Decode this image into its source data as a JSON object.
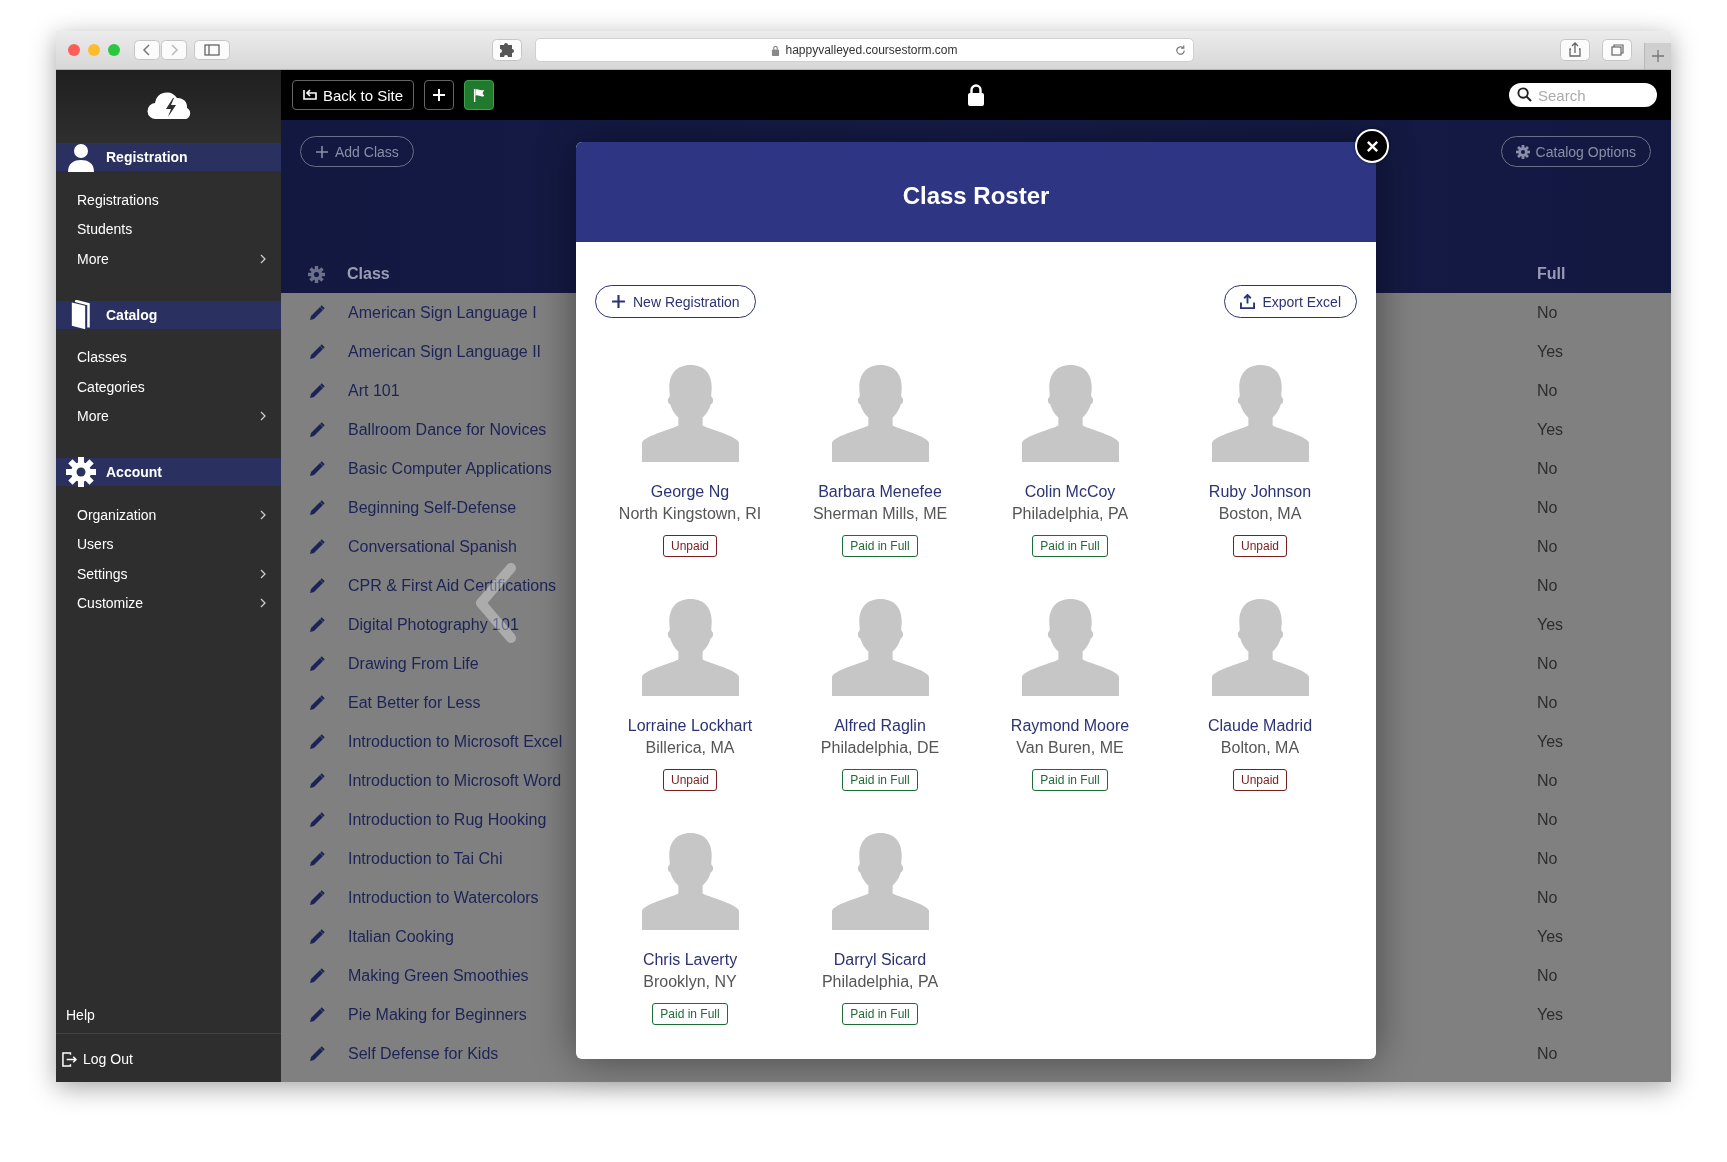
{
  "browser": {
    "url": "happyvalleyed.coursestorm.com"
  },
  "sidebar": {
    "sections": [
      {
        "title": "Registration",
        "kind": "person",
        "items": [
          {
            "label": "Registrations",
            "has_submenu": false
          },
          {
            "label": "Students",
            "has_submenu": false
          },
          {
            "label": "More",
            "has_submenu": true
          }
        ]
      },
      {
        "title": "Catalog",
        "kind": "book",
        "items": [
          {
            "label": "Classes",
            "has_submenu": false
          },
          {
            "label": "Categories",
            "has_submenu": false
          },
          {
            "label": "More",
            "has_submenu": true
          }
        ]
      },
      {
        "title": "Account",
        "kind": "gear",
        "items": [
          {
            "label": "Organization",
            "has_submenu": true
          },
          {
            "label": "Users",
            "has_submenu": false
          },
          {
            "label": "Settings",
            "has_submenu": true
          },
          {
            "label": "Customize",
            "has_submenu": true
          }
        ]
      }
    ],
    "help": "Help",
    "logout": "Log Out"
  },
  "topbar": {
    "back_button": "Back to Site",
    "search": {
      "placeholder": "Search"
    }
  },
  "catalog": {
    "add_button": "Add Class",
    "options_button": "Catalog Options",
    "columns": [
      "Class",
      "Full"
    ],
    "rows": [
      {
        "class": "American Sign Language I",
        "full": "No"
      },
      {
        "class": "American Sign Language II",
        "full": "Yes"
      },
      {
        "class": "Art 101",
        "full": "No"
      },
      {
        "class": "Ballroom Dance for Novices",
        "full": "Yes"
      },
      {
        "class": "Basic Computer Applications",
        "full": "No"
      },
      {
        "class": "Beginning Self-Defense",
        "full": "No"
      },
      {
        "class": "Conversational Spanish",
        "full": "No"
      },
      {
        "class": "CPR & First Aid Certifications",
        "full": "No"
      },
      {
        "class": "Digital Photography 101",
        "full": "Yes"
      },
      {
        "class": "Drawing From Life",
        "full": "No"
      },
      {
        "class": "Eat Better for Less",
        "full": "No"
      },
      {
        "class": "Introduction to Microsoft Excel",
        "full": "Yes"
      },
      {
        "class": "Introduction to Microsoft Word",
        "full": "No"
      },
      {
        "class": "Introduction to Rug Hooking",
        "full": "No"
      },
      {
        "class": "Introduction to Tai Chi",
        "full": "No"
      },
      {
        "class": "Introduction to Watercolors",
        "full": "No"
      },
      {
        "class": "Italian Cooking",
        "full": "Yes"
      },
      {
        "class": "Making Green Smoothies",
        "full": "No"
      },
      {
        "class": "Pie Making for Beginners",
        "full": "Yes"
      },
      {
        "class": "Self Defense for Kids",
        "full": "No"
      }
    ]
  },
  "modal": {
    "title": "Class Roster",
    "new_button": "New Registration",
    "export_button": "Export Excel",
    "students": [
      {
        "name": "George Ng",
        "location": "North Kingstown, RI",
        "payment": "Unpaid",
        "paid": false
      },
      {
        "name": "Barbara Menefee",
        "location": "Sherman Mills, ME",
        "payment": "Paid in Full",
        "paid": true
      },
      {
        "name": "Colin McCoy",
        "location": "Philadelphia, PA",
        "payment": "Paid in Full",
        "paid": true
      },
      {
        "name": "Ruby Johnson",
        "location": "Boston, MA",
        "payment": "Unpaid",
        "paid": false
      },
      {
        "name": "Lorraine Lockhart",
        "location": "Billerica, MA",
        "payment": "Unpaid",
        "paid": false
      },
      {
        "name": "Alfred Raglin",
        "location": "Philadelphia, DE",
        "payment": "Paid in Full",
        "paid": true
      },
      {
        "name": "Raymond Moore",
        "location": "Van Buren, ME",
        "payment": "Paid in Full",
        "paid": true
      },
      {
        "name": "Claude Madrid",
        "location": "Bolton, MA",
        "payment": "Unpaid",
        "paid": false
      },
      {
        "name": "Chris Laverty",
        "location": "Brooklyn, NY",
        "payment": "Paid in Full",
        "paid": true
      },
      {
        "name": "Darryl Sicard",
        "location": "Philadelphia, PA",
        "payment": "Paid in Full",
        "paid": true
      }
    ]
  }
}
